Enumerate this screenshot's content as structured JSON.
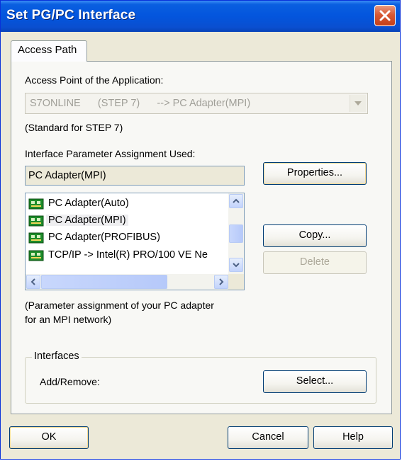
{
  "window": {
    "title": "Set PG/PC Interface"
  },
  "tabs": [
    {
      "label": "Access Path"
    }
  ],
  "access_point": {
    "label": "Access Point of the Application:",
    "value": "S7ONLINE      (STEP 7)      --> PC Adapter(MPI)",
    "note": "(Standard for STEP 7)"
  },
  "interface_param": {
    "label": "Interface Parameter Assignment Used:",
    "value": "PC Adapter(MPI)"
  },
  "list": {
    "items": [
      {
        "label": "PC Adapter(Auto)",
        "selected": false
      },
      {
        "label": "PC Adapter(MPI)",
        "selected": true
      },
      {
        "label": "PC Adapter(PROFIBUS)",
        "selected": false
      },
      {
        "label": "TCP/IP -> Intel(R) PRO/100 VE Ne",
        "selected": false
      }
    ]
  },
  "description": {
    "line1": "(Parameter assignment of your PC adapter",
    "line2": "for an MPI network)"
  },
  "buttons": {
    "properties": "Properties...",
    "copy": "Copy...",
    "delete": "Delete",
    "select": "Select...",
    "ok": "OK",
    "cancel": "Cancel",
    "help": "Help"
  },
  "interfaces": {
    "group_label": "Interfaces",
    "add_remove_label": "Add/Remove:"
  },
  "icons": [
    "close-icon",
    "combo-arrow-icon",
    "network-adapter-icon",
    "scroll-up-icon",
    "scroll-down-icon",
    "scroll-left-icon",
    "scroll-right-icon"
  ],
  "colors": {
    "title_bar": "#0355dd",
    "close_button": "#d85a35",
    "dialog_bg": "#ece9d8"
  }
}
